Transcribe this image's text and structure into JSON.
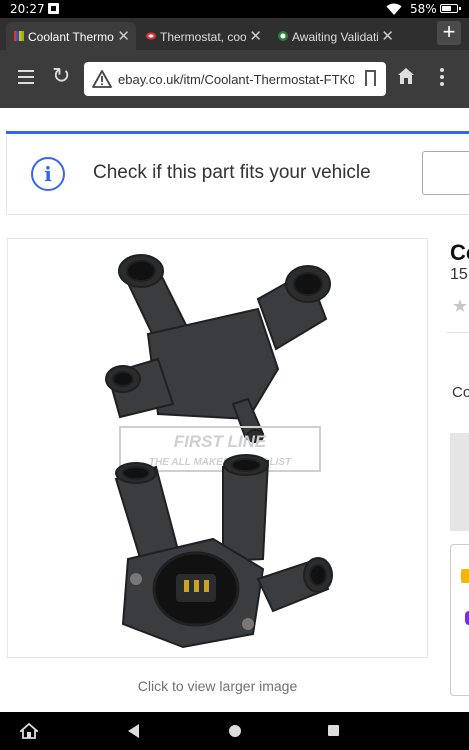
{
  "status_bar": {
    "time": "20:27",
    "battery_percent": "58%",
    "icons": [
      "notification-icon",
      "wifi-icon",
      "battery-icon"
    ]
  },
  "tabs": [
    {
      "label": "Coolant Thermo",
      "active": true,
      "favicon": "ebay-favicon"
    },
    {
      "label": "Thermostat, cool",
      "active": false,
      "favicon": "car-favicon"
    },
    {
      "label": "Awaiting Validati",
      "active": false,
      "favicon": "green-circle-favicon"
    }
  ],
  "new_tab_label": "+",
  "toolbar": {
    "url": "ebay.co.uk/itm/Coolant-Thermostat-FTK0"
  },
  "page": {
    "fit_check_text": "Check if this part fits your vehicle",
    "info_icon_glyph": "i",
    "image_caption": "Click to view larger image",
    "watermark_line1": "FIRST LINE",
    "watermark_line2": "THE ALL MAKES SPECIALIST",
    "right_title_fragment": "Co",
    "right_sub_fragment": "15",
    "right_condition_fragment": "Co",
    "accent_color": "#3665f3"
  }
}
